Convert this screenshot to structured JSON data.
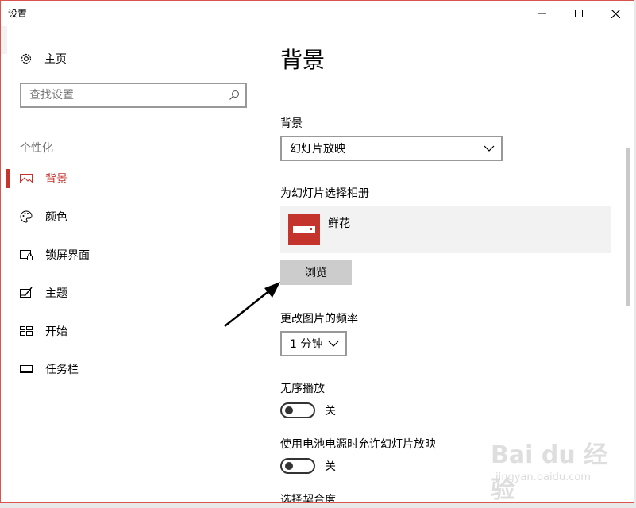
{
  "window": {
    "title": "设置",
    "controls": {
      "minimize": "minimize-icon",
      "maximize": "maximize-icon",
      "close": "close-icon"
    }
  },
  "sidebar": {
    "home_label": "主页",
    "search": {
      "placeholder": "查找设置",
      "value": ""
    },
    "section_label": "个性化",
    "items": [
      {
        "label": "背景",
        "icon": "picture-icon",
        "active": true
      },
      {
        "label": "颜色",
        "icon": "palette-icon",
        "active": false
      },
      {
        "label": "锁屏界面",
        "icon": "lock-screen-icon",
        "active": false
      },
      {
        "label": "主题",
        "icon": "theme-icon",
        "active": false
      },
      {
        "label": "开始",
        "icon": "start-menu-icon",
        "active": false
      },
      {
        "label": "任务栏",
        "icon": "taskbar-icon",
        "active": false
      }
    ]
  },
  "main": {
    "title": "背景",
    "background": {
      "label": "背景",
      "selected": "幻灯片放映"
    },
    "album": {
      "label": "为幻灯片选择相册",
      "name": "鲜花",
      "browse_label": "浏览"
    },
    "frequency": {
      "label": "更改图片的频率",
      "selected": "1 分钟"
    },
    "shuffle": {
      "label": "无序播放",
      "state": "关",
      "on": false
    },
    "battery": {
      "label": "使用电池电源时允许幻灯片放映",
      "state": "关",
      "on": false
    },
    "fit_label": "选择契合度"
  },
  "watermark": {
    "brand": "Bai du 经验",
    "sub": "jingyan.baidu.com"
  },
  "colors": {
    "accent": "#c4342d",
    "window_border": "#d9534f",
    "album_bg": "#f2f2f2",
    "button_bg": "#cccccc"
  }
}
